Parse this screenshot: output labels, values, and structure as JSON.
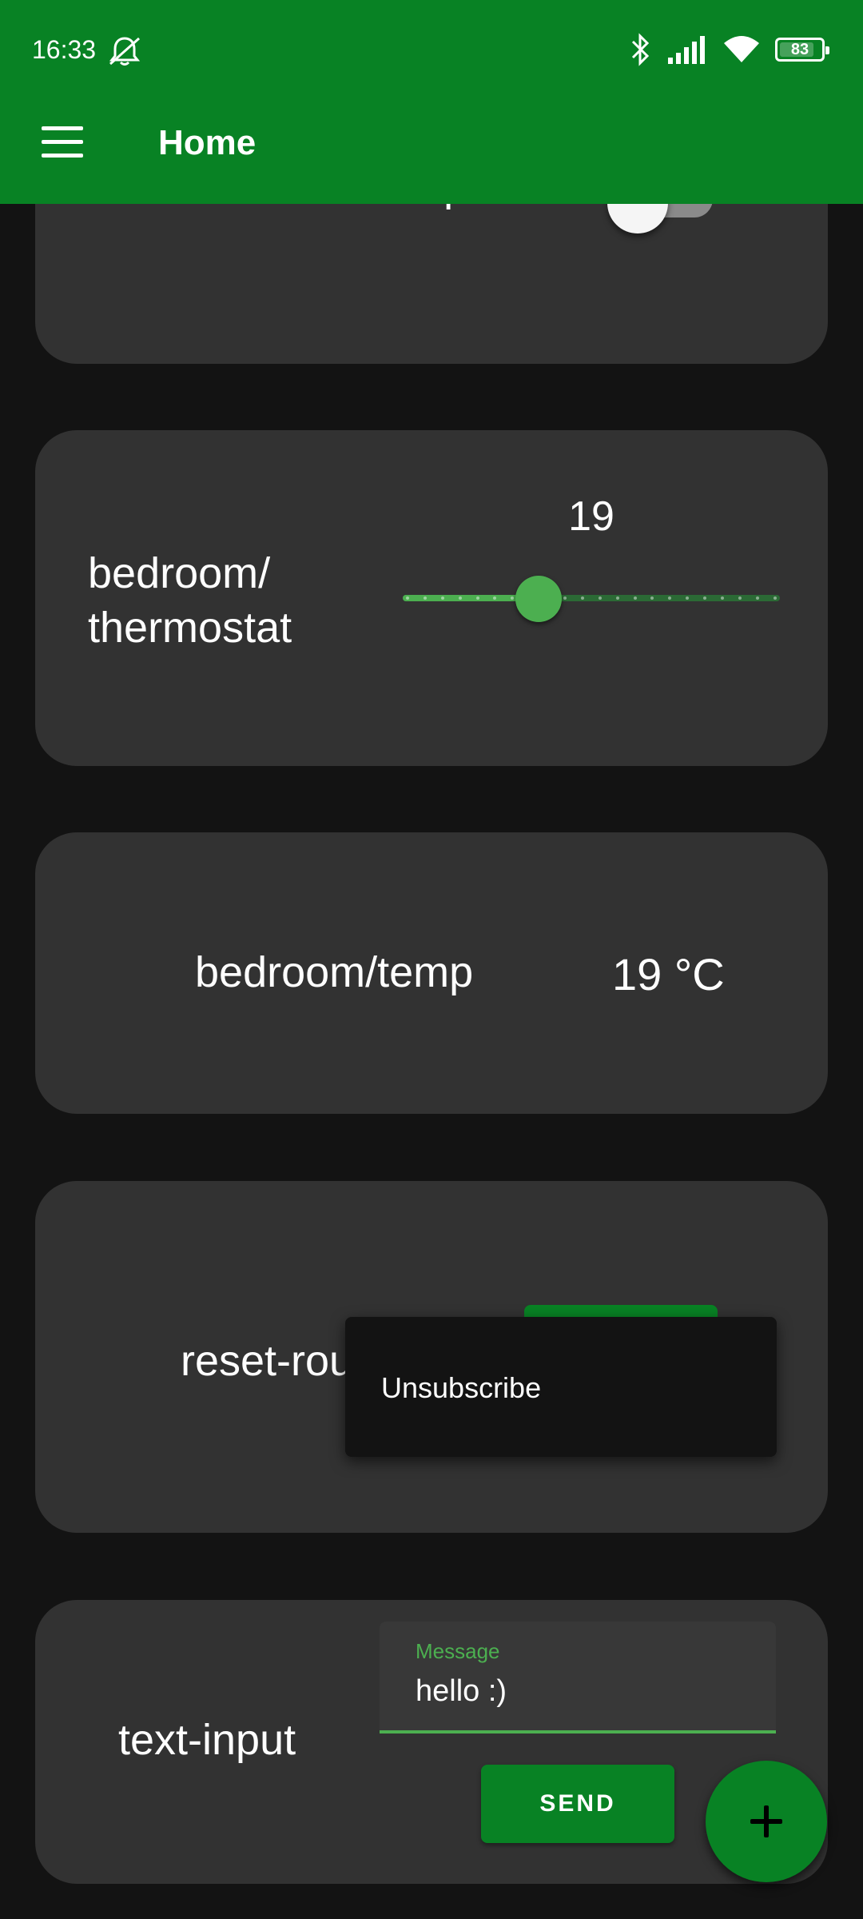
{
  "status_bar": {
    "time": "16:33",
    "battery": "83",
    "battery_level": 0.83,
    "icons": [
      "bell-off-icon",
      "bluetooth-icon",
      "signal-icon",
      "wifi-icon",
      "battery-icon"
    ]
  },
  "app_bar": {
    "title": "Home",
    "menu_icon": "menu-icon"
  },
  "colors": {
    "primary": "#088224",
    "accent": "#4caf50",
    "background": "#131313",
    "card": "#323232"
  },
  "cards": {
    "lamp": {
      "label": "bedroom/lamp",
      "switch_on": false
    },
    "thermostat": {
      "label_line1": "bedroom/",
      "label_line2": "thermostat",
      "value": "19",
      "value_fraction": 0.36
    },
    "temp": {
      "label": "bedroom/temp",
      "value": "19 °C"
    },
    "reset": {
      "label": "reset-routine"
    },
    "text_input": {
      "label": "text-input",
      "field_label": "Message",
      "field_value": "hello :)",
      "send_label": "SEND"
    }
  },
  "popup_menu": {
    "items": [
      "Unsubscribe"
    ]
  },
  "fab": {
    "icon": "plus-icon"
  }
}
